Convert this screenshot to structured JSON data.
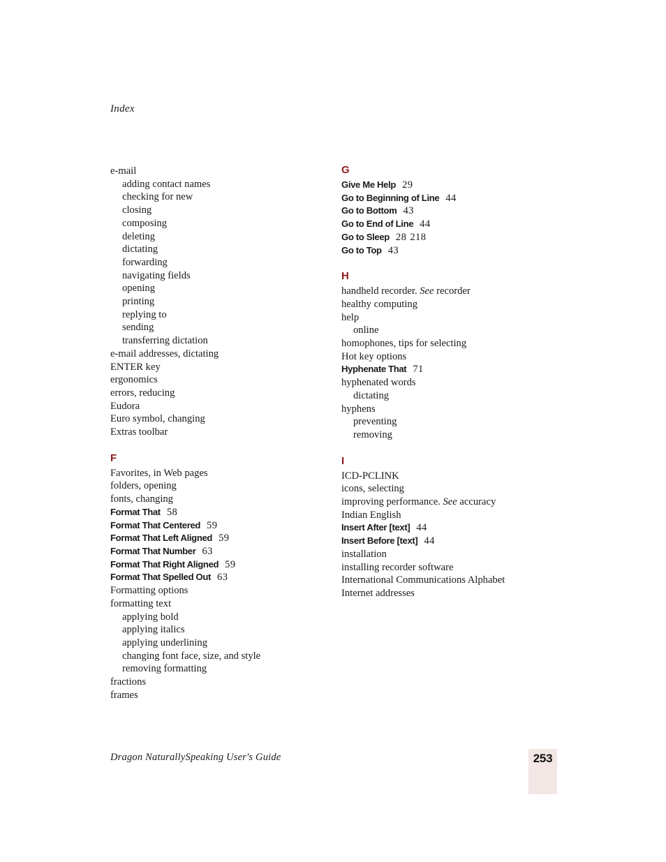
{
  "running_head": "Index",
  "footer": {
    "book_title": "Dragon NaturallySpeaking User's Guide",
    "page_number": "253",
    "folio_box_color": "#f2e7e5"
  },
  "colors": {
    "letter_heading": "#8c1a1f",
    "body_text": "#1a1a1a"
  },
  "columns": [
    {
      "name": "left-column",
      "sections": [
        {
          "letter": "",
          "entries": [
            {
              "term": "e-mail",
              "level": 1,
              "style": "normal",
              "pages": []
            },
            {
              "term": "adding contact names",
              "level": 2,
              "style": "normal",
              "pages": []
            },
            {
              "term": "checking for new",
              "level": 2,
              "style": "normal",
              "pages": []
            },
            {
              "term": "closing",
              "level": 2,
              "style": "normal",
              "pages": []
            },
            {
              "term": "composing",
              "level": 2,
              "style": "normal",
              "pages": []
            },
            {
              "term": "deleting",
              "level": 2,
              "style": "normal",
              "pages": []
            },
            {
              "term": "dictating",
              "level": 2,
              "style": "normal",
              "pages": []
            },
            {
              "term": "forwarding",
              "level": 2,
              "style": "normal",
              "pages": []
            },
            {
              "term": "navigating fields",
              "level": 2,
              "style": "normal",
              "pages": []
            },
            {
              "term": "opening",
              "level": 2,
              "style": "normal",
              "pages": []
            },
            {
              "term": "printing",
              "level": 2,
              "style": "normal",
              "pages": []
            },
            {
              "term": "replying to",
              "level": 2,
              "style": "normal",
              "pages": []
            },
            {
              "term": "sending",
              "level": 2,
              "style": "normal",
              "pages": []
            },
            {
              "term": "transferring dictation",
              "level": 2,
              "style": "normal",
              "pages": []
            },
            {
              "term": "e-mail addresses, dictating",
              "level": 1,
              "style": "normal",
              "pages": []
            },
            {
              "term": "ENTER key",
              "level": 1,
              "style": "normal",
              "pages": []
            },
            {
              "term": "ergonomics",
              "level": 1,
              "style": "normal",
              "pages": []
            },
            {
              "term": "errors, reducing",
              "level": 1,
              "style": "normal",
              "pages": []
            },
            {
              "term": "Eudora",
              "level": 1,
              "style": "normal",
              "pages": []
            },
            {
              "term": "Euro symbol, changing",
              "level": 1,
              "style": "normal",
              "pages": []
            },
            {
              "term": "Extras toolbar",
              "level": 1,
              "style": "normal",
              "pages": []
            }
          ]
        },
        {
          "letter": "F",
          "entries": [
            {
              "term": "Favorites, in Web pages",
              "level": 1,
              "style": "normal",
              "pages": []
            },
            {
              "term": "folders, opening",
              "level": 1,
              "style": "normal",
              "pages": []
            },
            {
              "term": "fonts, changing",
              "level": 1,
              "style": "normal",
              "pages": []
            },
            {
              "term": "Format That",
              "level": 1,
              "style": "command",
              "pages": [
                "58"
              ]
            },
            {
              "term": "Format That Centered",
              "level": 1,
              "style": "command",
              "pages": [
                "59"
              ]
            },
            {
              "term": "Format That Left Aligned",
              "level": 1,
              "style": "command",
              "pages": [
                "59"
              ]
            },
            {
              "term": "Format That Number",
              "level": 1,
              "style": "command",
              "pages": [
                "63"
              ]
            },
            {
              "term": "Format That Right Aligned",
              "level": 1,
              "style": "command",
              "pages": [
                "59"
              ]
            },
            {
              "term": "Format That Spelled Out",
              "level": 1,
              "style": "command",
              "pages": [
                "63"
              ]
            },
            {
              "term": "Formatting options",
              "level": 1,
              "style": "normal",
              "pages": []
            },
            {
              "term": "formatting text",
              "level": 1,
              "style": "normal",
              "pages": []
            },
            {
              "term": "applying bold",
              "level": 2,
              "style": "normal",
              "pages": []
            },
            {
              "term": "applying italics",
              "level": 2,
              "style": "normal",
              "pages": []
            },
            {
              "term": "applying underlining",
              "level": 2,
              "style": "normal",
              "pages": []
            },
            {
              "term": "changing font face, size, and style",
              "level": 2,
              "style": "normal",
              "pages": []
            },
            {
              "term": "removing formatting",
              "level": 2,
              "style": "normal",
              "pages": []
            },
            {
              "term": "fractions",
              "level": 1,
              "style": "normal",
              "pages": []
            },
            {
              "term": "frames",
              "level": 1,
              "style": "normal",
              "pages": []
            }
          ]
        }
      ]
    },
    {
      "name": "right-column",
      "sections": [
        {
          "letter": "G",
          "entries": [
            {
              "term": "Give Me Help",
              "level": 1,
              "style": "command",
              "pages": [
                "29"
              ]
            },
            {
              "term": "Go to Beginning of Line",
              "level": 1,
              "style": "command",
              "pages": [
                "44"
              ]
            },
            {
              "term": "Go to Bottom",
              "level": 1,
              "style": "command",
              "pages": [
                "43"
              ]
            },
            {
              "term": "Go to End of Line",
              "level": 1,
              "style": "command",
              "pages": [
                "44"
              ]
            },
            {
              "term": "Go to Sleep",
              "level": 1,
              "style": "command",
              "pages": [
                "28",
                "218"
              ]
            },
            {
              "term": "Go to Top",
              "level": 1,
              "style": "command",
              "pages": [
                "43"
              ]
            }
          ]
        },
        {
          "letter": "H",
          "entries": [
            {
              "term": "handheld recorder. ",
              "see": "See",
              "after": " recorder",
              "level": 1,
              "style": "cross-reference",
              "pages": []
            },
            {
              "term": "healthy computing",
              "level": 1,
              "style": "normal",
              "pages": []
            },
            {
              "term": "help",
              "level": 1,
              "style": "normal",
              "pages": []
            },
            {
              "term": "online",
              "level": 2,
              "style": "normal",
              "pages": []
            },
            {
              "term": "homophones, tips for selecting",
              "level": 1,
              "style": "normal",
              "pages": []
            },
            {
              "term": "Hot key options",
              "level": 1,
              "style": "normal",
              "pages": []
            },
            {
              "term": "Hyphenate That",
              "level": 1,
              "style": "command",
              "pages": [
                "71"
              ]
            },
            {
              "term": "hyphenated words",
              "level": 1,
              "style": "normal",
              "pages": []
            },
            {
              "term": "dictating",
              "level": 2,
              "style": "normal",
              "pages": []
            },
            {
              "term": "hyphens",
              "level": 1,
              "style": "normal",
              "pages": []
            },
            {
              "term": "preventing",
              "level": 2,
              "style": "normal",
              "pages": []
            },
            {
              "term": "removing",
              "level": 2,
              "style": "normal",
              "pages": []
            }
          ]
        },
        {
          "letter": "I",
          "entries": [
            {
              "term": "ICD-PCLINK",
              "level": 1,
              "style": "normal",
              "pages": []
            },
            {
              "term": "icons, selecting",
              "level": 1,
              "style": "normal",
              "pages": []
            },
            {
              "term": "improving performance. ",
              "see": "See",
              "after": " accuracy",
              "level": 1,
              "style": "cross-reference",
              "pages": []
            },
            {
              "term": "Indian English",
              "level": 1,
              "style": "normal",
              "pages": []
            },
            {
              "term": "Insert After [text]",
              "level": 1,
              "style": "command",
              "pages": [
                "44"
              ]
            },
            {
              "term": "Insert Before [text]",
              "level": 1,
              "style": "command",
              "pages": [
                "44"
              ]
            },
            {
              "term": "installation",
              "level": 1,
              "style": "normal",
              "pages": []
            },
            {
              "term": "installing recorder software",
              "level": 1,
              "style": "normal",
              "pages": []
            },
            {
              "term": "International Communications Alphabet",
              "level": 1,
              "style": "normal",
              "pages": []
            },
            {
              "term": "Internet addresses",
              "level": 1,
              "style": "normal",
              "pages": []
            }
          ]
        }
      ]
    }
  ]
}
